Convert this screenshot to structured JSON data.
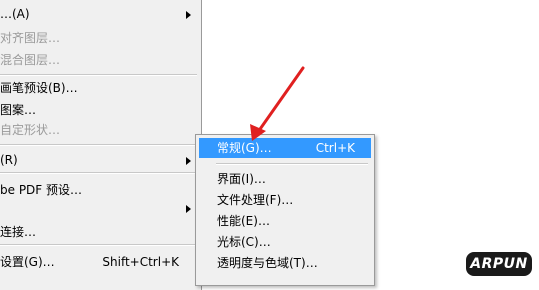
{
  "main_menu": {
    "items": [
      {
        "label": "…(A)",
        "shortcut": "",
        "has_submenu": true,
        "enabled": true
      },
      {
        "label": "对齐图层…",
        "shortcut": "",
        "has_submenu": false,
        "enabled": false
      },
      {
        "label": "混合图层…",
        "shortcut": "",
        "has_submenu": false,
        "enabled": false
      },
      {
        "label": "画笔预设(B)…",
        "shortcut": "",
        "has_submenu": false,
        "enabled": true
      },
      {
        "label": "图案…",
        "shortcut": "",
        "has_submenu": false,
        "enabled": true
      },
      {
        "label": "自定形状…",
        "shortcut": "",
        "has_submenu": false,
        "enabled": false
      },
      {
        "label": "(R)",
        "shortcut": "",
        "has_submenu": true,
        "enabled": true
      },
      {
        "label": "be PDF 预设…",
        "shortcut": "",
        "has_submenu": false,
        "enabled": true
      },
      {
        "label": "",
        "shortcut": "",
        "has_submenu": true,
        "enabled": true
      },
      {
        "label": "连接…",
        "shortcut": "",
        "has_submenu": false,
        "enabled": true
      },
      {
        "label": "设置(G)…",
        "shortcut": "Shift+Ctrl+K",
        "has_submenu": false,
        "enabled": true
      }
    ]
  },
  "preferences_submenu": {
    "items": [
      {
        "label": "常规(G)…",
        "shortcut": "Ctrl+K",
        "highlighted": true
      },
      {
        "label": "界面(I)…",
        "shortcut": "",
        "highlighted": false
      },
      {
        "label": "文件处理(F)…",
        "shortcut": "",
        "highlighted": false
      },
      {
        "label": "性能(E)…",
        "shortcut": "",
        "highlighted": false
      },
      {
        "label": "光标(C)…",
        "shortcut": "",
        "highlighted": false
      },
      {
        "label": "透明度与色域(T)…",
        "shortcut": "",
        "highlighted": false
      }
    ]
  },
  "annotation": {
    "arrow_color": "#e02020"
  },
  "watermark": {
    "text": "ARPUN"
  },
  "colors": {
    "highlight": "#3399ff",
    "menu_bg": "#f0f0f0",
    "disabled_text": "#9a9a9a"
  }
}
